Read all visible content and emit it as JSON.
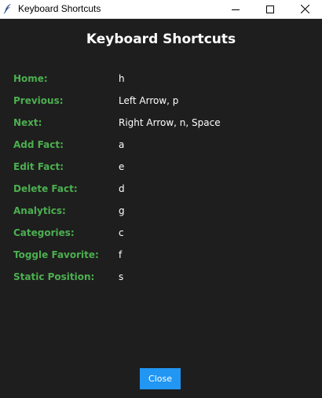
{
  "window": {
    "title": "Keyboard Shortcuts",
    "app_icon": "feather-icon",
    "controls": [
      "minimize-icon",
      "maximize-icon",
      "close-icon"
    ]
  },
  "dialog": {
    "heading": "Keyboard Shortcuts",
    "shortcuts": [
      {
        "action": "Home:",
        "keys": "h"
      },
      {
        "action": "Previous:",
        "keys": "Left Arrow, p"
      },
      {
        "action": "Next:",
        "keys": "Right Arrow, n, Space"
      },
      {
        "action": "Add Fact:",
        "keys": "a"
      },
      {
        "action": "Edit Fact:",
        "keys": "e"
      },
      {
        "action": "Delete Fact:",
        "keys": "d"
      },
      {
        "action": "Analytics:",
        "keys": "g"
      },
      {
        "action": "Categories:",
        "keys": "c"
      },
      {
        "action": "Toggle Favorite:",
        "keys": "f"
      },
      {
        "action": "Static Position:",
        "keys": "s"
      }
    ],
    "close_label": "Close"
  },
  "colors": {
    "background": "#1e1e1e",
    "action_label": "#4caf50",
    "key_text": "#ffffff",
    "button": "#2196f3"
  }
}
